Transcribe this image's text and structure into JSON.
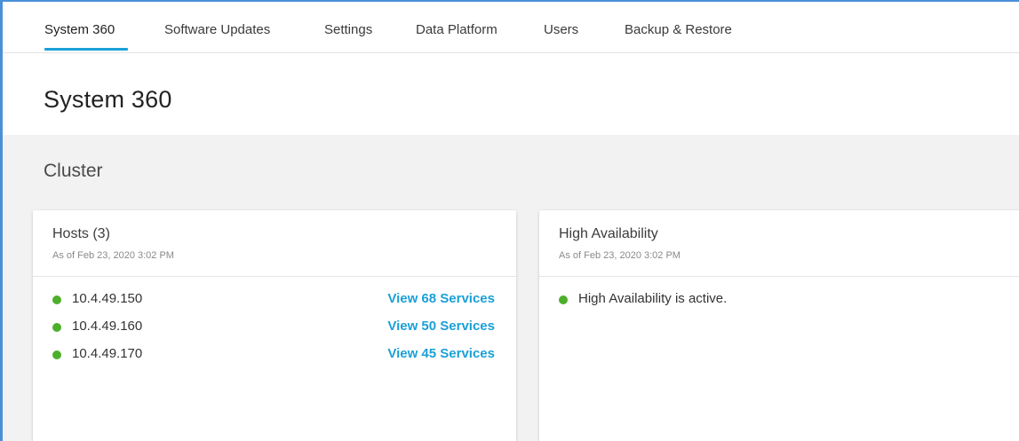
{
  "tabs": [
    {
      "label": "System 360",
      "active": true
    },
    {
      "label": "Software Updates",
      "active": false
    },
    {
      "label": "Settings",
      "active": false
    },
    {
      "label": "Data Platform",
      "active": false
    },
    {
      "label": "Users",
      "active": false
    },
    {
      "label": "Backup & Restore",
      "active": false
    }
  ],
  "page": {
    "title": "System 360"
  },
  "cluster": {
    "section_title": "Cluster",
    "hosts_card": {
      "title": "Hosts (3)",
      "subtitle": "As of Feb 23, 2020 3:02 PM",
      "hosts": [
        {
          "ip": "10.4.49.150",
          "status": "active",
          "services_link": "View 68 Services"
        },
        {
          "ip": "10.4.49.160",
          "status": "active",
          "services_link": "View 50 Services"
        },
        {
          "ip": "10.4.49.170",
          "status": "active",
          "services_link": "View 45 Services"
        }
      ]
    },
    "ha_card": {
      "title": "High Availability",
      "subtitle": "As of Feb 23, 2020 3:02 PM",
      "status_text": "High Availability is active."
    }
  },
  "colors": {
    "accent": "#1ba0d7",
    "status_ok": "#4caf2a",
    "content_bg": "#f2f2f2"
  }
}
